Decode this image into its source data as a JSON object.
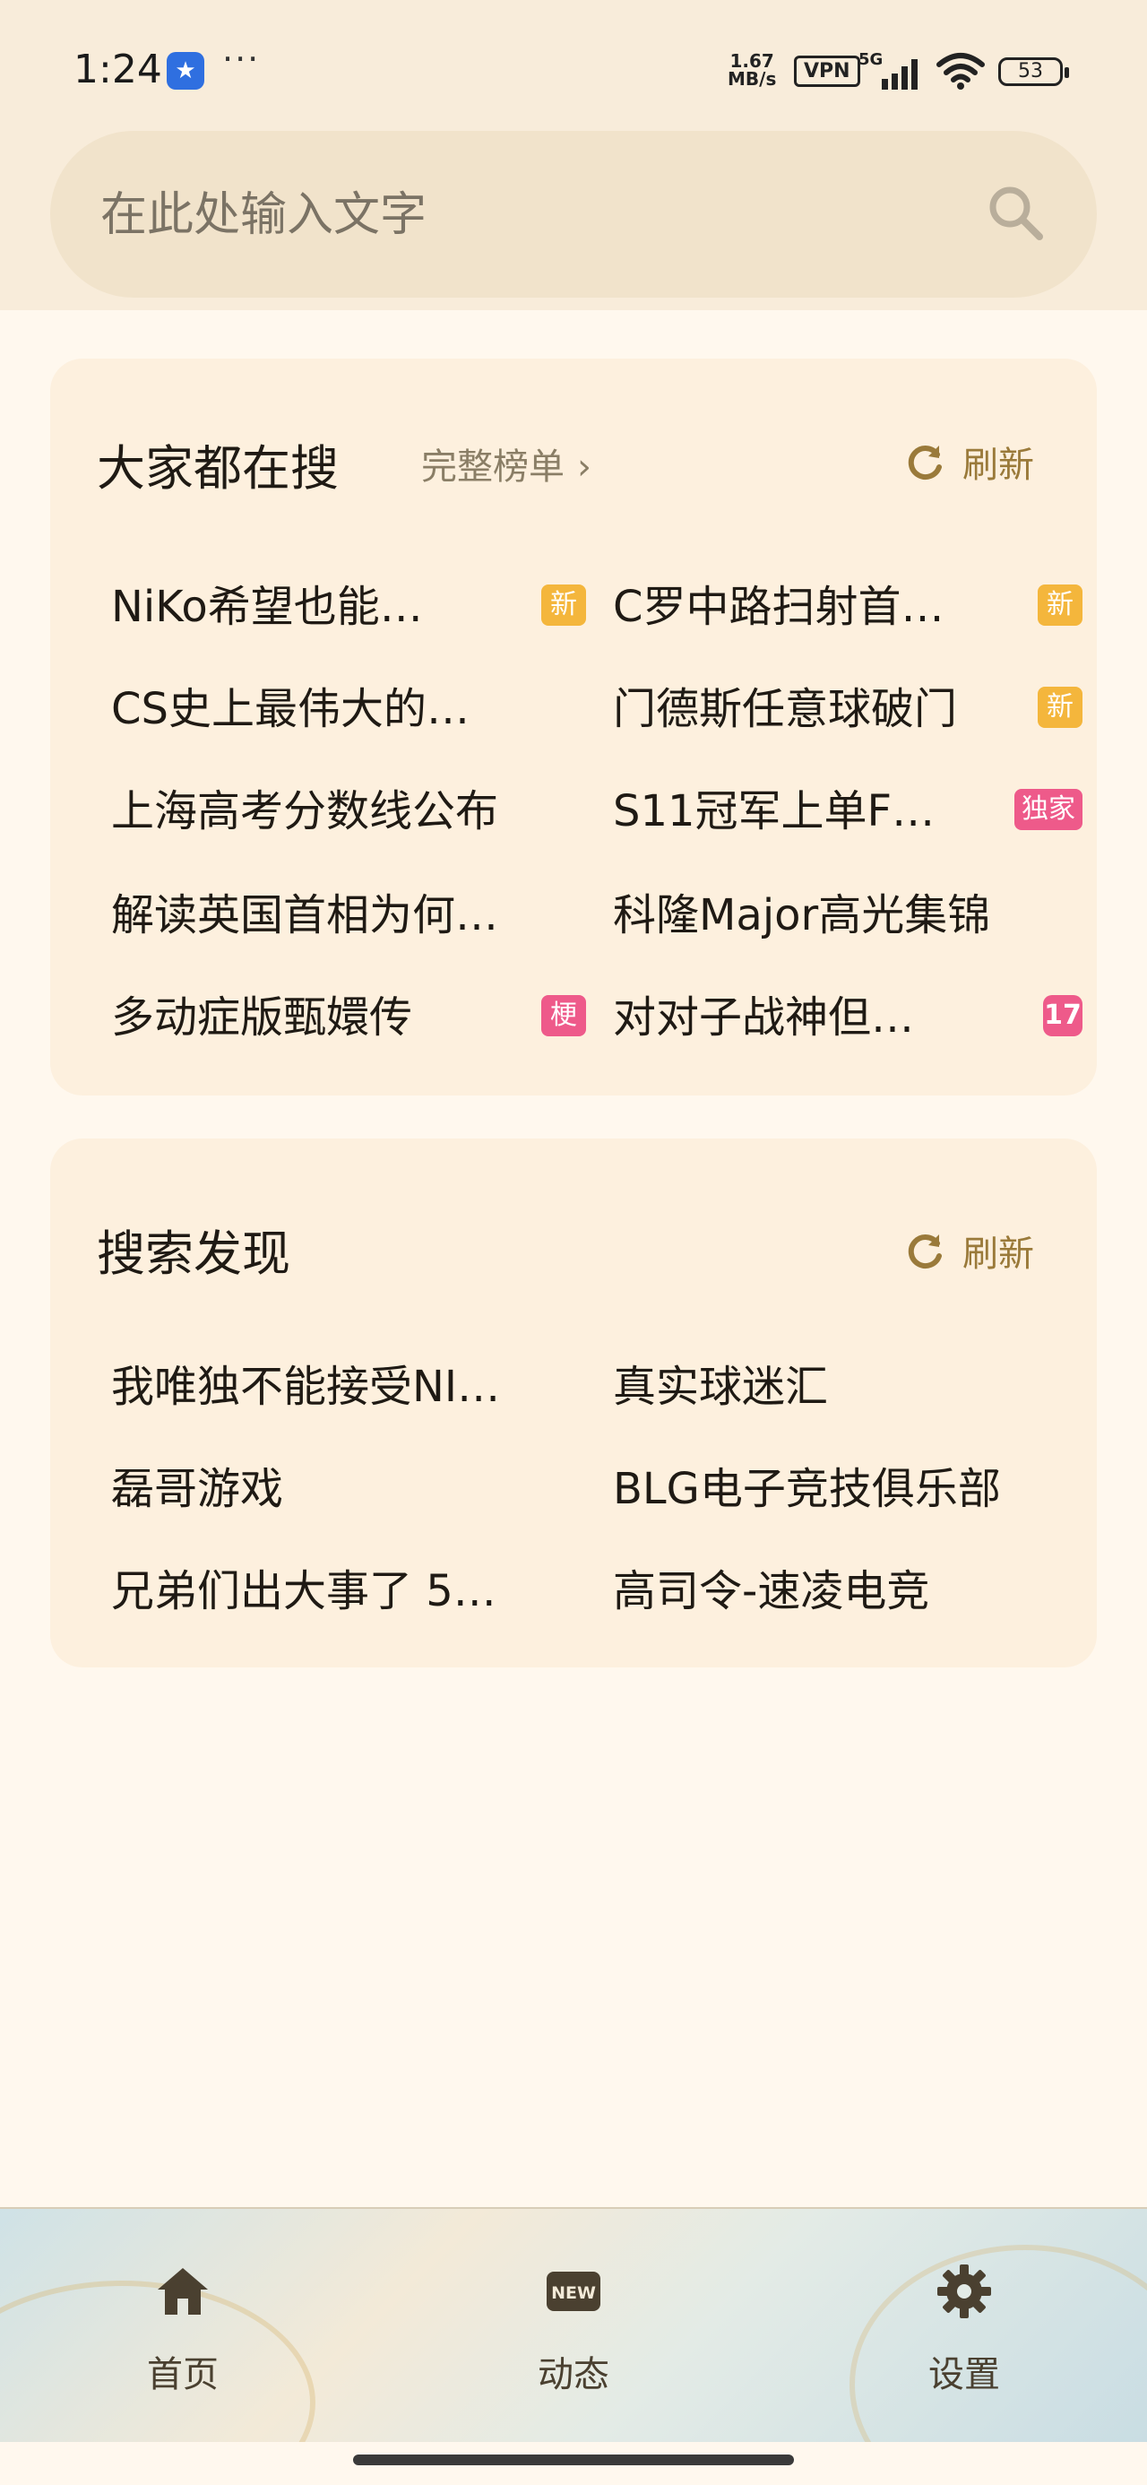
{
  "status_bar": {
    "time": "1:24",
    "more": "···",
    "net_speed_value": "1.67",
    "net_speed_unit": "MB/s",
    "vpn": "VPN",
    "network_type": "5G",
    "battery": "53"
  },
  "search": {
    "placeholder": "在此处输入文字"
  },
  "trending": {
    "title": "大家都在搜",
    "full_rank_label": "完整榜单",
    "refresh_label": "刷新",
    "items": [
      {
        "text": "NiKo希望也能…",
        "tag": "新"
      },
      {
        "text": "C罗中路扫射首…",
        "tag": "新"
      },
      {
        "text": "CS史上最伟大的…",
        "tag": ""
      },
      {
        "text": "门德斯任意球破门",
        "tag": "新"
      },
      {
        "text": "上海高考分数线公布",
        "tag": ""
      },
      {
        "text": "S11冠军上单F…",
        "tag": "独家"
      },
      {
        "text": "解读英国首相为何…",
        "tag": ""
      },
      {
        "text": "科隆Major高光集锦",
        "tag": ""
      },
      {
        "text": "多动症版甄嬛传",
        "tag": "梗"
      },
      {
        "text": "对对子战神但…",
        "tag": "17"
      }
    ]
  },
  "discover": {
    "title": "搜索发现",
    "refresh_label": "刷新",
    "items": [
      {
        "text": "我唯独不能接受NI…"
      },
      {
        "text": "真实球迷汇"
      },
      {
        "text": "磊哥游戏"
      },
      {
        "text": "BLG电子竞技俱乐部"
      },
      {
        "text": "兄弟们出大事了 5…"
      },
      {
        "text": "高司令-速凌电竞"
      }
    ]
  },
  "bottom_nav": {
    "items": [
      {
        "label": "首页",
        "icon": "home-icon"
      },
      {
        "label": "动态",
        "icon": "new-icon"
      },
      {
        "label": "设置",
        "icon": "gear-icon"
      }
    ],
    "new_badge_text": "NEW"
  },
  "colors": {
    "accent": "#9a7a3a",
    "tag_new": "#f4b63c",
    "tag_pink": "#ee5a8a",
    "card_bg": "#fdf0de",
    "page_bg": "#fff8ee"
  }
}
